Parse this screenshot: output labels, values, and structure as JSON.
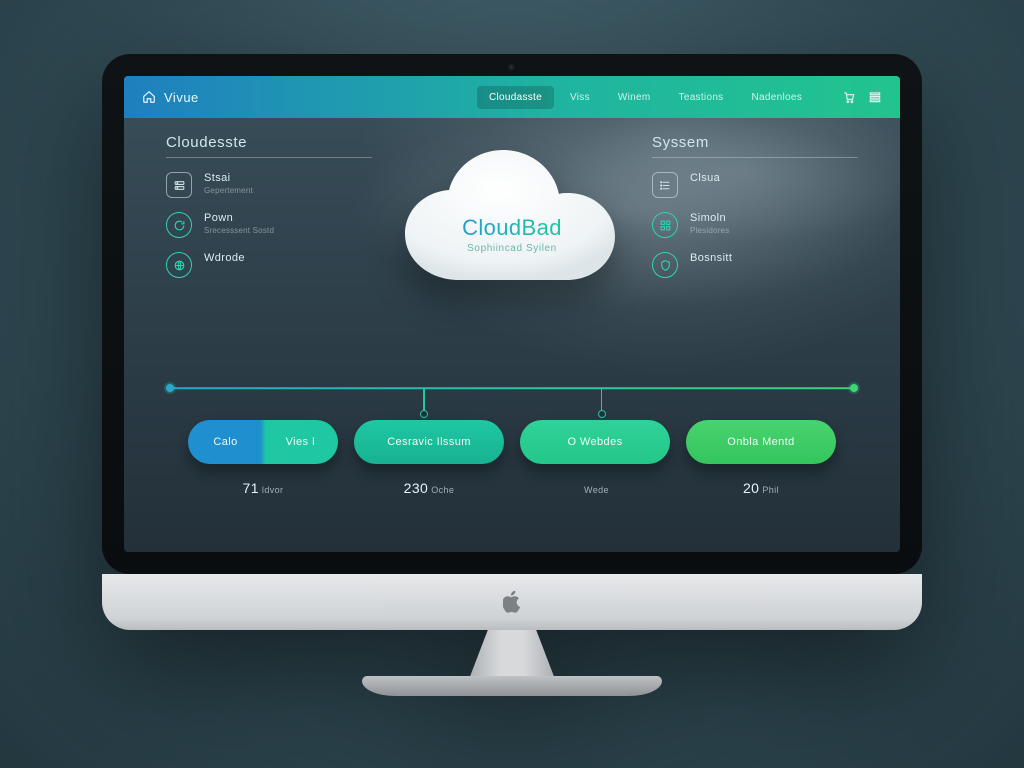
{
  "brand": {
    "name": "Vivue"
  },
  "nav": {
    "items": [
      {
        "label": "Cloudasste"
      },
      {
        "label": "Viss"
      },
      {
        "label": "Winem"
      },
      {
        "label": "Teastions"
      },
      {
        "label": "Nadenloes"
      }
    ],
    "active_index": 0
  },
  "left": {
    "heading": "Cloudesste",
    "features": [
      {
        "icon": "server",
        "title": "Stsai",
        "sub": "Gepertement"
      },
      {
        "icon": "refresh",
        "title": "Pown",
        "sub": "Srecesssent Sostd"
      },
      {
        "icon": "globe",
        "title": "Wdrode",
        "sub": ""
      }
    ]
  },
  "right": {
    "heading": "Syssem",
    "features": [
      {
        "icon": "list",
        "title": "Clsua",
        "sub": ""
      },
      {
        "icon": "grid",
        "title": "Simoln",
        "sub": "Plesidores"
      },
      {
        "icon": "shield",
        "title": "Bosnsitt",
        "sub": ""
      }
    ]
  },
  "hero": {
    "title": "CloudBad",
    "subtitle": "Sophiincad Syilen"
  },
  "pills": [
    {
      "style": "duo",
      "labels": [
        "Calo",
        "Vies I"
      ]
    },
    {
      "style": "teal",
      "labels": [
        "Cesravic Ilssum"
      ]
    },
    {
      "style": "mint",
      "labels": [
        "O Webdes"
      ]
    },
    {
      "style": "green",
      "labels": [
        "Onbla Mentd"
      ]
    }
  ],
  "stats": [
    {
      "value": "71",
      "unit": "ldvor"
    },
    {
      "value": "230",
      "unit": "Oche"
    },
    {
      "value": "",
      "unit": "Wede"
    },
    {
      "value": "20",
      "unit": "Phil"
    }
  ],
  "colors": {
    "blue": "#1f8fcf",
    "teal": "#1fc7a3",
    "green": "#3bd27a"
  }
}
